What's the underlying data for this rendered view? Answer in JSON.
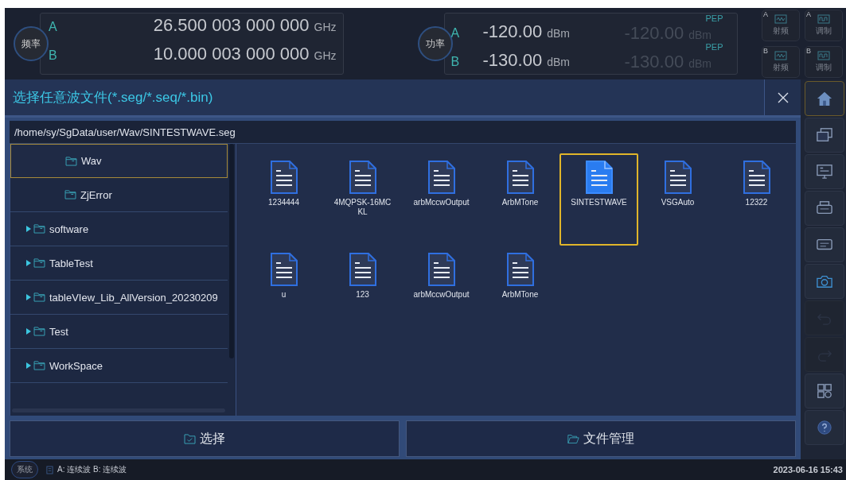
{
  "frequency": {
    "label": "频率",
    "rows": [
      {
        "channel": "A",
        "value": "26.500 003 000 000",
        "unit": "GHz"
      },
      {
        "channel": "B",
        "value": "10.000 003 000 000",
        "unit": "GHz"
      }
    ]
  },
  "power": {
    "label": "功率",
    "rows": [
      {
        "channel": "A",
        "value": "-120.00",
        "unit": "dBm",
        "pep_label": "PEP",
        "pep_value": "-120.00",
        "pep_unit": "dBm"
      },
      {
        "channel": "B",
        "value": "-130.00",
        "unit": "dBm",
        "pep_label": "PEP",
        "pep_value": "-130.00",
        "pep_unit": "dBm"
      }
    ]
  },
  "mode_buttons": [
    {
      "channel": "A",
      "label": "射频",
      "kind": "rf"
    },
    {
      "channel": "A",
      "label": "调制",
      "kind": "mod"
    },
    {
      "channel": "B",
      "label": "射频",
      "kind": "rf"
    },
    {
      "channel": "B",
      "label": "调制",
      "kind": "mod"
    }
  ],
  "dialog": {
    "title": "选择任意波文件(*.seg/*.seq/*.bin)",
    "path": "/home/sy/SgData/user/Wav/SINTESTWAVE.seg",
    "tree": [
      {
        "children": [
          {
            "name": "Wav",
            "selected": true
          },
          {
            "name": "ZjError",
            "selected": false
          }
        ]
      },
      {
        "name": "software",
        "selected": false,
        "expanded": false
      },
      {
        "name": "TableTest",
        "selected": false,
        "expanded": false
      },
      {
        "name": "tableVIew_Lib_AllVersion_20230209",
        "selected": false,
        "expanded": false
      },
      {
        "name": "Test",
        "selected": false,
        "expanded": false
      },
      {
        "name": "WorkSpace",
        "selected": false,
        "expanded": false
      }
    ],
    "files": [
      {
        "name": "1234444",
        "selected": false
      },
      {
        "name": "4MQPSK-16MCKL",
        "selected": false
      },
      {
        "name": "arbMccwOutput",
        "selected": false
      },
      {
        "name": "ArbMTone",
        "selected": false
      },
      {
        "name": "SINTESTWAVE",
        "selected": true
      },
      {
        "name": "VSGAuto",
        "selected": false
      },
      {
        "name": "12322",
        "selected": false
      },
      {
        "name": "u",
        "selected": false
      },
      {
        "name": "123",
        "selected": false
      },
      {
        "name": "arbMccwOutput",
        "selected": false
      },
      {
        "name": "ArbMTone",
        "selected": false
      }
    ],
    "buttons": [
      {
        "label": "选择",
        "kind": "select"
      },
      {
        "label": "文件管理",
        "kind": "manage"
      }
    ]
  },
  "sidebar": [
    {
      "kind": "home",
      "disabled": false,
      "selected": true
    },
    {
      "kind": "windows",
      "disabled": false,
      "selected": false
    },
    {
      "kind": "monitor",
      "disabled": false,
      "selected": false
    },
    {
      "kind": "scpi-printer",
      "disabled": false,
      "selected": false
    },
    {
      "kind": "scpi",
      "disabled": false,
      "selected": false
    },
    {
      "kind": "camera",
      "disabled": false,
      "selected": false
    },
    {
      "kind": "undo",
      "disabled": true,
      "selected": false
    },
    {
      "kind": "redo",
      "disabled": true,
      "selected": false
    },
    {
      "kind": "grid",
      "disabled": false,
      "selected": false
    },
    {
      "kind": "help",
      "disabled": false,
      "selected": false
    }
  ],
  "status_bar": {
    "system_label": "系统",
    "mode": "A: 连续波 B: 连续波",
    "datetime": "2023-06-16 15:43"
  }
}
